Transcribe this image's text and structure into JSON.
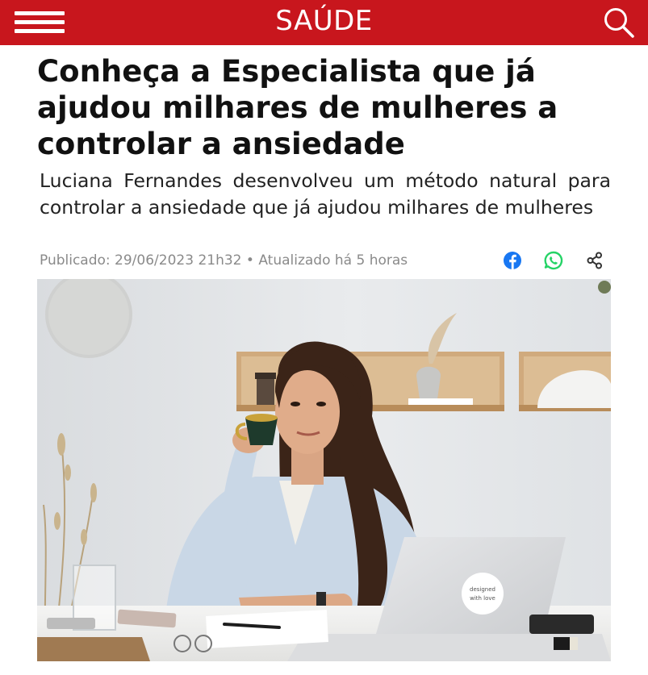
{
  "header": {
    "section_title": "SAÚDE",
    "menu_icon": "hamburger-menu-icon",
    "search_icon": "search-icon",
    "background_color": "#c8161d"
  },
  "article": {
    "headline": "Conheça a Especialista que já ajudou milhares de mulheres a controlar a ansiedade",
    "subtitle": "Luciana Fernandes desenvolveu um método natural para controlar a ansiedade que já ajudou milhares de mulheres",
    "published": "Publicado: 29/06/2023 21h32",
    "separator": "•",
    "updated": "Atualizado há 5 horas",
    "share": {
      "facebook_icon": "facebook-icon",
      "whatsapp_icon": "whatsapp-icon",
      "share_icon": "share-icon",
      "facebook_color": "#1877f2",
      "whatsapp_color": "#25d366"
    },
    "hero_image": {
      "sticker_line1": "designed",
      "sticker_line2": "with love"
    }
  }
}
